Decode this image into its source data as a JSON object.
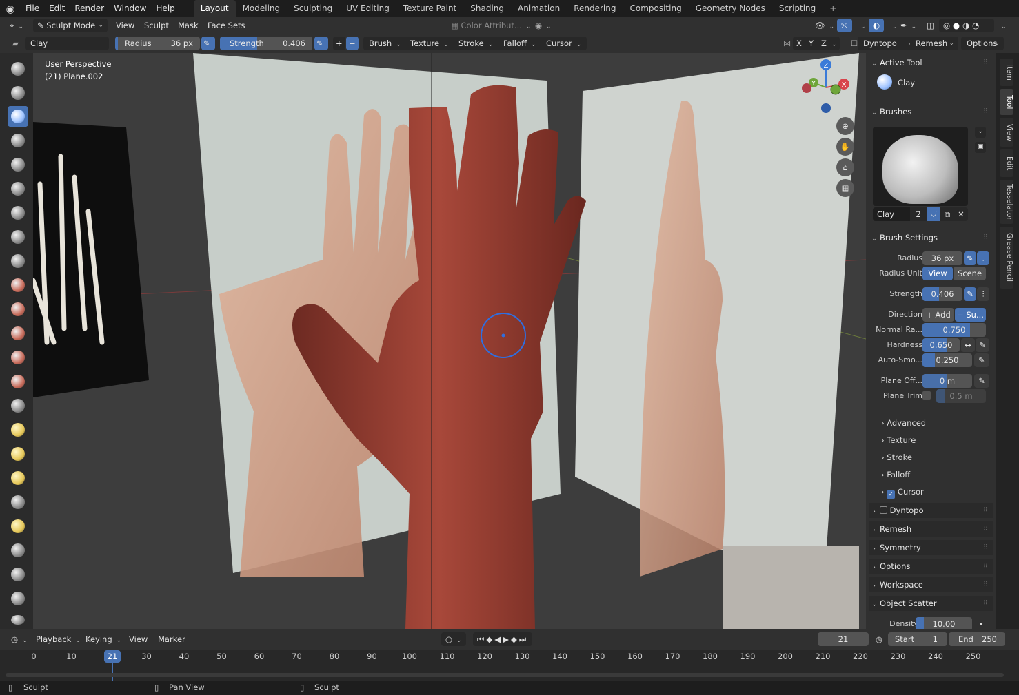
{
  "menus": [
    "File",
    "Edit",
    "Render",
    "Window",
    "Help"
  ],
  "workspaces": [
    "Layout",
    "Modeling",
    "Sculpting",
    "UV Editing",
    "Texture Paint",
    "Shading",
    "Animation",
    "Rendering",
    "Compositing",
    "Geometry Nodes",
    "Scripting"
  ],
  "header": {
    "mode": "Sculpt Mode",
    "menus": [
      "View",
      "Sculpt",
      "Mask",
      "Face Sets"
    ],
    "color_attr": "Color Attribut...",
    "dyntopo": "Dyntopo",
    "remesh": "Remesh",
    "options": "Options",
    "axes": [
      "X",
      "Y",
      "Z"
    ]
  },
  "toolsettings": {
    "brush_name": "Clay",
    "radius_label": "Radius",
    "radius_value": "36 px",
    "strength_label": "Strength",
    "strength_value": "0.406",
    "strength_fraction": 0.406,
    "dropdowns": [
      "Brush",
      "Texture",
      "Stroke",
      "Falloff",
      "Cursor"
    ]
  },
  "viewport": {
    "perspective": "User Perspective",
    "object": "(21) Plane.002",
    "gizmo_axes": {
      "z": "Z",
      "y": "Y",
      "x": "X"
    }
  },
  "panel": {
    "active_tool_title": "Active Tool",
    "active_tool_name": "Clay",
    "brushes_title": "Brushes",
    "brush_name": "Clay",
    "brush_users": "2",
    "brush_settings_title": "Brush Settings",
    "radius_label": "Radius",
    "radius_value": "36 px",
    "radius_unit_label": "Radius Unit",
    "radius_unit_view": "View",
    "radius_unit_scene": "Scene",
    "strength_label": "Strength",
    "strength_value": "0.406",
    "direction_label": "Direction",
    "direction_add": "Add",
    "direction_sub": "Su...",
    "normal_radius_label": "Normal Ra...",
    "normal_radius_value": "0.750",
    "normal_radius_fraction": 0.75,
    "hardness_label": "Hardness",
    "hardness_value": "0.650",
    "hardness_fraction": 0.65,
    "autosmooth_label": "Auto-Smo...",
    "autosmooth_value": "0.250",
    "autosmooth_fraction": 0.25,
    "plane_offset_label": "Plane Off...",
    "plane_offset_value": "0 m",
    "plane_trim_label": "Plane Trim",
    "plane_trim_value": "0.5 m",
    "subsections": [
      "Advanced",
      "Texture",
      "Stroke",
      "Falloff",
      "Cursor"
    ],
    "sections": [
      "Dyntopo",
      "Remesh",
      "Symmetry",
      "Options",
      "Workspace",
      "Object Scatter"
    ],
    "density_label": "Density",
    "density_value": "10.00"
  },
  "side_tabs": [
    "Item",
    "Tool",
    "View",
    "Edit",
    "Tesselator",
    "Grease Pencil"
  ],
  "timeline": {
    "playback": "Playback",
    "keying": "Keying",
    "view": "View",
    "marker": "Marker",
    "current_frame": "21",
    "start_label": "Start",
    "start_value": "1",
    "end_label": "End",
    "end_value": "250",
    "playhead": "21",
    "ticks": [
      "0",
      "10",
      "30",
      "40",
      "50",
      "60",
      "70",
      "80",
      "90",
      "100",
      "110",
      "120",
      "130",
      "140",
      "150",
      "160",
      "170",
      "180",
      "190",
      "200",
      "210",
      "220",
      "230",
      "240",
      "250"
    ]
  },
  "status": {
    "left": "Sculpt",
    "middle": "Pan View",
    "right": "Sculpt"
  },
  "colors": {
    "accent": "#4772b3",
    "clay": "#8e3a2e",
    "header": "#303030",
    "background": "#1d1d1d"
  }
}
